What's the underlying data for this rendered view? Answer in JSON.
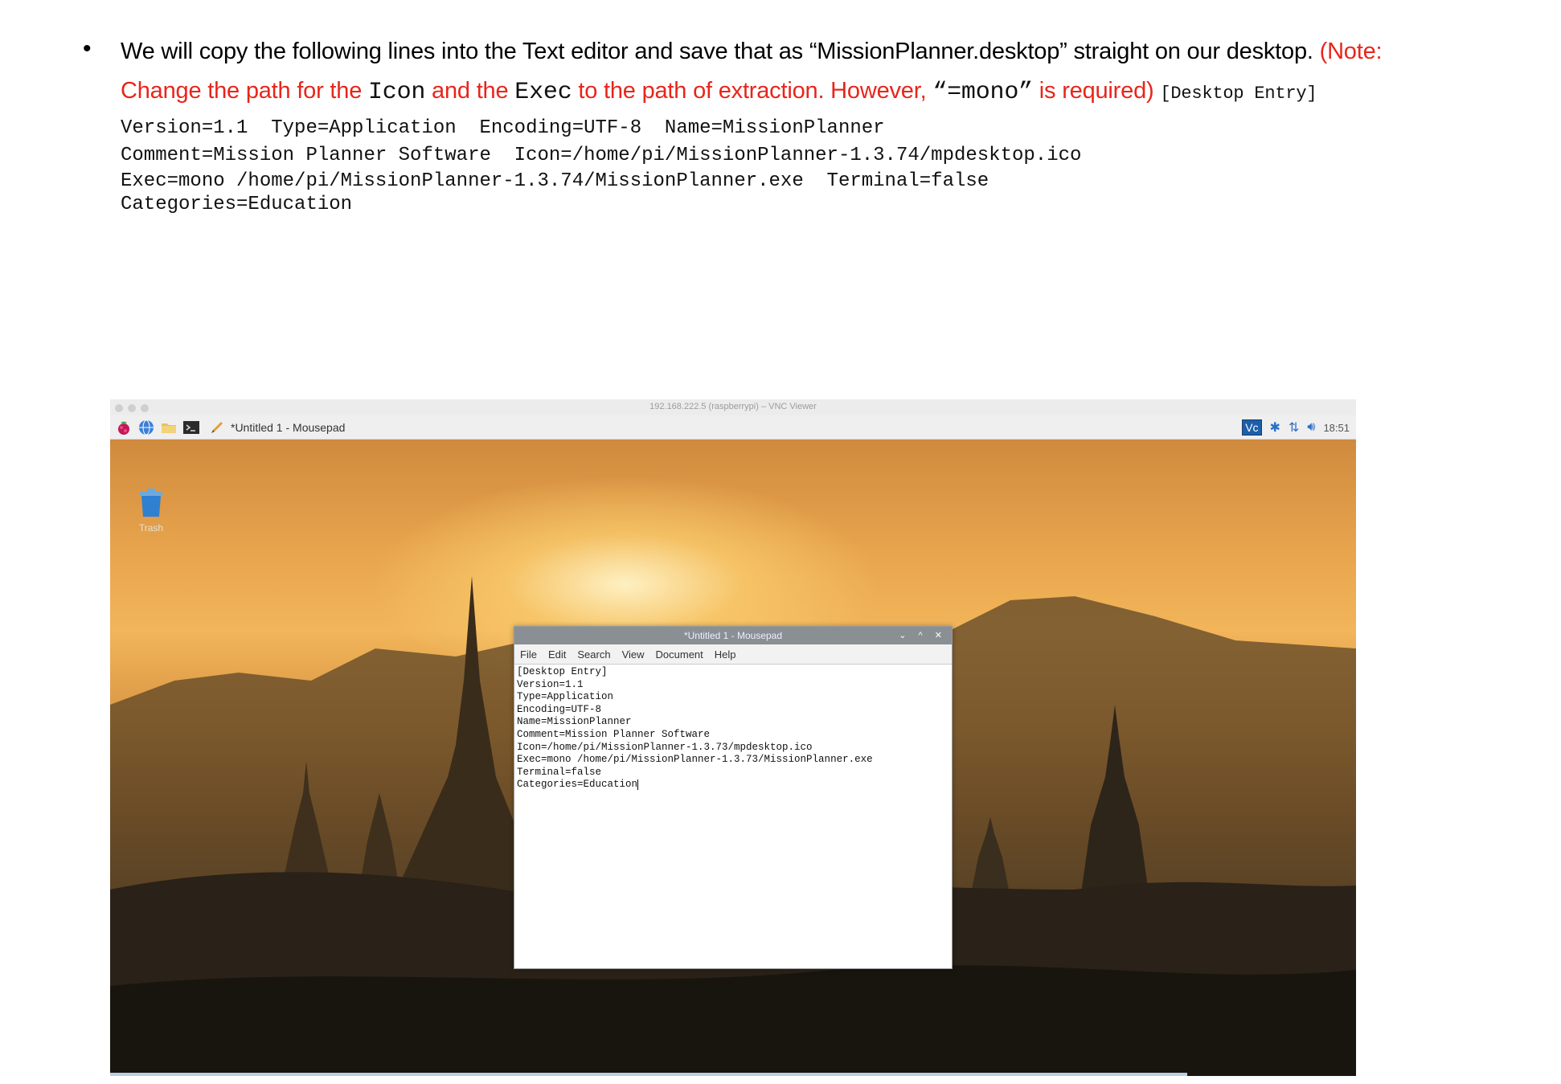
{
  "instruction": {
    "bullet": "•",
    "text_black": "We will copy the following lines into the Text editor and save that as “MissionPlanner.desktop” straight on our desktop.",
    "note_open": "(Note:",
    "note_change": "Change the path for the ",
    "note_icon": "Icon",
    "note_and": " and the ",
    "note_exec": "Exec",
    "note_to_path": " to the path of extraction. However, ",
    "note_mono": "“=mono”",
    "note_required": " is required)",
    "desktop_entry": "[Desktop Entry]"
  },
  "code_lines": [
    "Version=1.1  Type=Application  Encoding=UTF-8  Name=MissionPlanner",
    "Comment=Mission Planner Software  Icon=/home/pi/MissionPlanner-1.3.74/mpdesktop.ico",
    "Exec=mono /home/pi/MissionPlanner-1.3.74/MissionPlanner.exe  Terminal=false",
    "Categories=Education"
  ],
  "screenshot": {
    "vnc_title": "192.168.222.5 (raspberrypi) – VNC Viewer",
    "taskbar_task": "*Untitled 1 - Mousepad",
    "clock": "18:51",
    "vnc_badge": "Vc",
    "trash_label": "Trash",
    "editor": {
      "title": "*Untitled 1 - Mousepad",
      "controls": "⌄ ^ ✕",
      "menu": [
        "File",
        "Edit",
        "Search",
        "View",
        "Document",
        "Help"
      ],
      "lines": [
        "[Desktop Entry]",
        "Version=1.1",
        "Type=Application",
        "Encoding=UTF-8",
        "Name=MissionPlanner",
        "Comment=Mission Planner Software",
        "Icon=/home/pi/MissionPlanner-1.3.73/mpdesktop.ico",
        "Exec=mono /home/pi/MissionPlanner-1.3.73/MissionPlanner.exe",
        "Terminal=false",
        "Categories=Education"
      ]
    }
  }
}
